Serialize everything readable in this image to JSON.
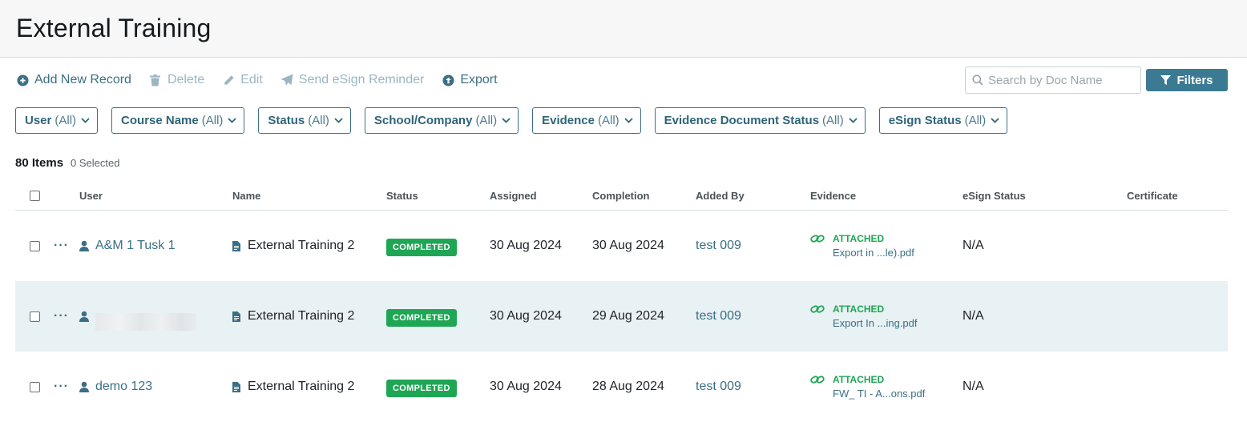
{
  "page": {
    "title": "External Training"
  },
  "toolbar": {
    "add": "Add New Record",
    "delete": "Delete",
    "edit": "Edit",
    "reminder": "Send eSign Reminder",
    "export": "Export",
    "search_placeholder": "Search by Doc Name",
    "filters": "Filters"
  },
  "chips": [
    {
      "label": "User",
      "value": "(All)"
    },
    {
      "label": "Course Name",
      "value": "(All)"
    },
    {
      "label": "Status",
      "value": "(All)"
    },
    {
      "label": "School/Company",
      "value": "(All)"
    },
    {
      "label": "Evidence",
      "value": "(All)"
    },
    {
      "label": "Evidence Document Status",
      "value": "(All)"
    },
    {
      "label": "eSign Status",
      "value": "(All)"
    }
  ],
  "summary": {
    "items": "80 Items",
    "selected": "0 Selected"
  },
  "columns": {
    "user": "User",
    "name": "Name",
    "status": "Status",
    "assigned": "Assigned",
    "completion": "Completion",
    "added_by": "Added By",
    "evidence": "Evidence",
    "esign": "eSign Status",
    "certificate": "Certificate"
  },
  "rows": [
    {
      "user": "A&M 1 Tusk 1",
      "name": "External Training 2",
      "status": "COMPLETED",
      "assigned": "30 Aug 2024",
      "completion": "30 Aug 2024",
      "added_by": "test 009",
      "evidence_status": "ATTACHED",
      "evidence_file": "Export in ...le).pdf",
      "esign": "N/A"
    },
    {
      "user": "",
      "name": "External Training 2",
      "status": "COMPLETED",
      "assigned": "30 Aug 2024",
      "completion": "29 Aug 2024",
      "added_by": "test 009",
      "evidence_status": "ATTACHED",
      "evidence_file": "Export In ...ing.pdf",
      "esign": "N/A"
    },
    {
      "user": "demo 123",
      "name": "External Training 2",
      "status": "COMPLETED",
      "assigned": "30 Aug 2024",
      "completion": "28 Aug 2024",
      "added_by": "test 009",
      "evidence_status": "ATTACHED",
      "evidence_file": "FW_ TI - A...ons.pdf",
      "esign": "N/A"
    }
  ],
  "colors": {
    "accent": "#3b6f85",
    "success": "#1fa654",
    "row_highlight": "#e8f1f4"
  }
}
